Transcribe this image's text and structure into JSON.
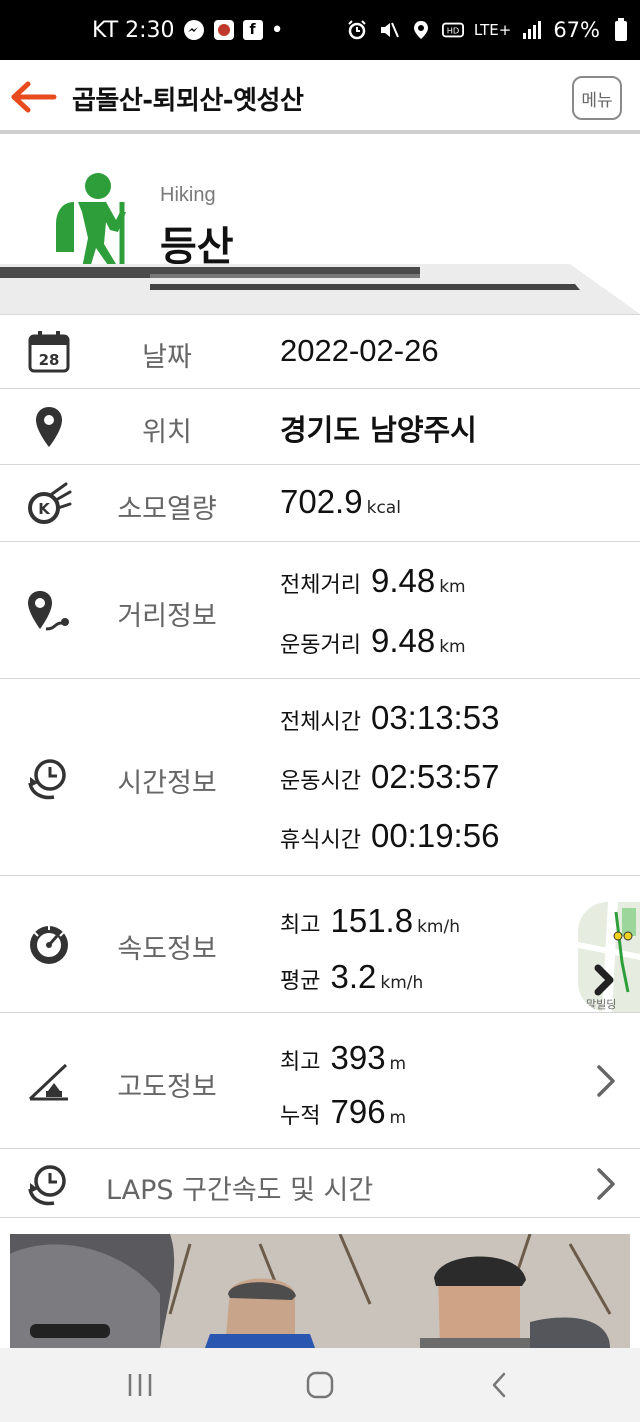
{
  "status_bar": {
    "carrier_time": "KT 2:30",
    "notif_icons": [
      "messenger-icon",
      "app-icon",
      "facebook-icon"
    ],
    "dot": "•",
    "right_icons": [
      "alarm-icon",
      "mute-icon",
      "location-icon",
      "hd-icon"
    ],
    "network": "LTE+",
    "battery": "67%"
  },
  "title_bar": {
    "title": "곱돌산-퇴뫼산-옛성산",
    "menu_label": "메뉴",
    "accent_color": "#e84b1e"
  },
  "header": {
    "activity_en": "Hiking",
    "activity_ko": "등산",
    "icon_color": "#2e9e3a",
    "calendar_day": "28"
  },
  "rows": {
    "date": {
      "label": "날짜",
      "value": "2022-02-26"
    },
    "location": {
      "label": "위치",
      "value": "경기도 남양주시"
    },
    "calories": {
      "label": "소모열량",
      "value": "702.9",
      "unit": "kcal",
      "icon_letter": "K"
    },
    "distance": {
      "label": "거리정보",
      "total_label": "전체거리",
      "total_value": "9.48",
      "total_unit": "km",
      "move_label": "운동거리",
      "move_value": "9.48",
      "move_unit": "km"
    },
    "time": {
      "label": "시간정보",
      "total_label": "전체시간",
      "total_value": "03:13:53",
      "move_label": "운동시간",
      "move_value": "02:53:57",
      "rest_label": "휴식시간",
      "rest_value": "00:19:56"
    },
    "speed": {
      "label": "속도정보",
      "max_label": "최고",
      "max_value": "151.8",
      "max_unit": "km/h",
      "avg_label": "평균",
      "avg_value": "3.2",
      "avg_unit": "km/h",
      "map_text": "말빌딩"
    },
    "altitude": {
      "label": "고도정보",
      "max_label": "최고",
      "max_value": "393",
      "max_unit": "m",
      "cum_label": "누적",
      "cum_value": "796",
      "cum_unit": "m"
    },
    "laps": {
      "label": "LAPS 구간속도 및 시간"
    }
  },
  "nav_bar": {
    "buttons": [
      "recents-icon",
      "home-icon",
      "back-icon"
    ]
  }
}
